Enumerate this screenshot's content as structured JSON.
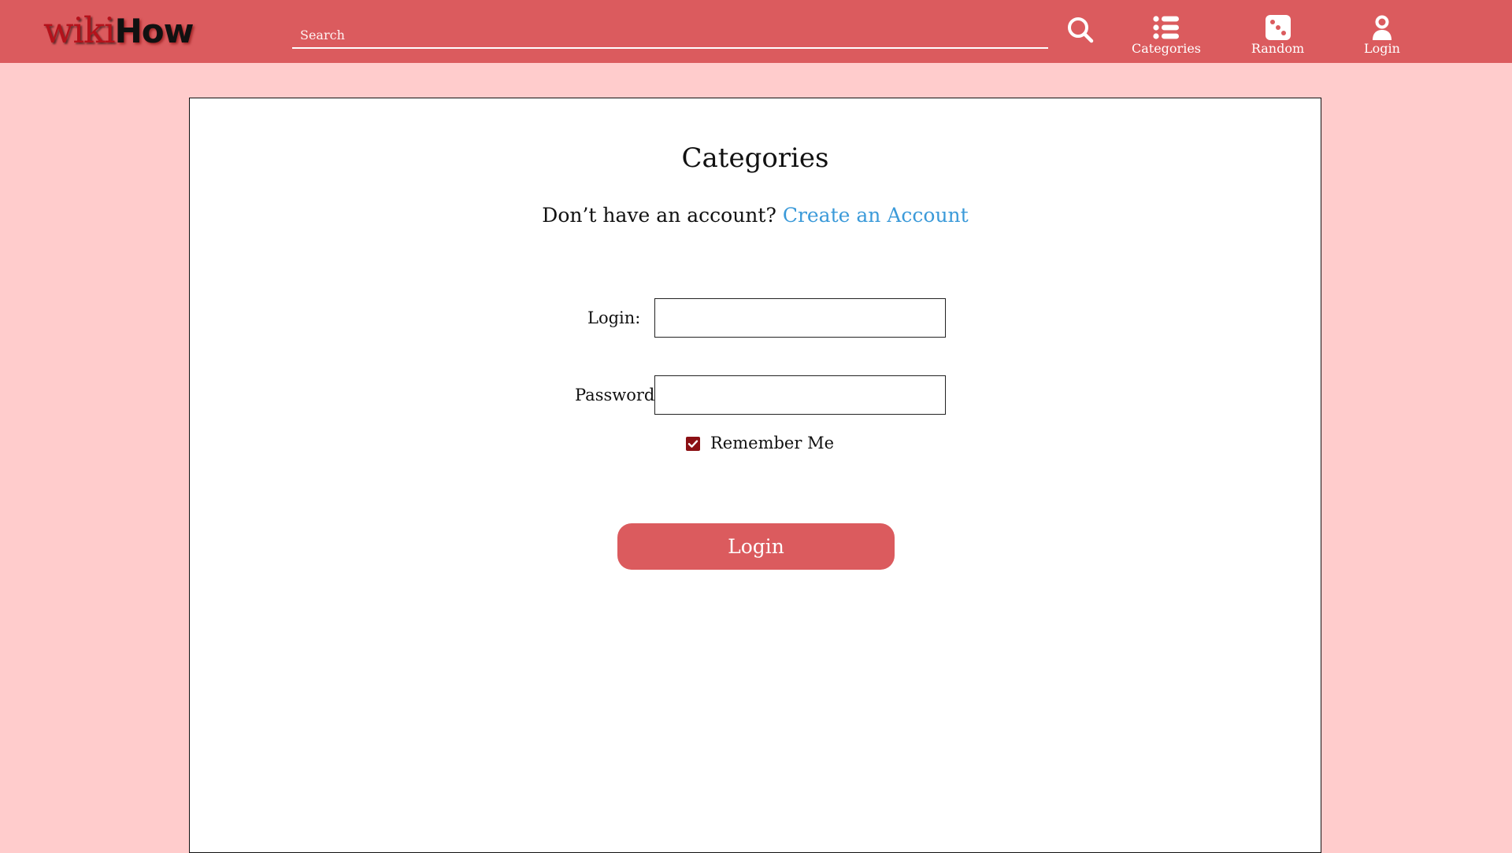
{
  "header": {
    "logo": {
      "wiki": "wiki",
      "how": "How"
    },
    "search": {
      "placeholder": "Search",
      "value": ""
    },
    "search_button_icon": "search-icon",
    "nav": [
      {
        "label": "Categories",
        "icon": "list-icon"
      },
      {
        "label": "Random",
        "icon": "dice-icon"
      },
      {
        "label": "Login",
        "icon": "user-icon"
      }
    ]
  },
  "main": {
    "title": "Categories",
    "signup_prompt": "Don’t have an account?",
    "signup_link": "Create an Account",
    "form": {
      "login_label": "Login:",
      "login_value": "",
      "password_label": "Password:",
      "password_value": "",
      "remember_label": "Remember Me",
      "remember_checked": true,
      "submit_label": "Login"
    }
  },
  "colors": {
    "header_bg": "#db5b5e",
    "page_bg": "#ffcccc",
    "link": "#3b9ad9",
    "checkbox": "#8b1014",
    "button_bg": "#db5b5e"
  }
}
